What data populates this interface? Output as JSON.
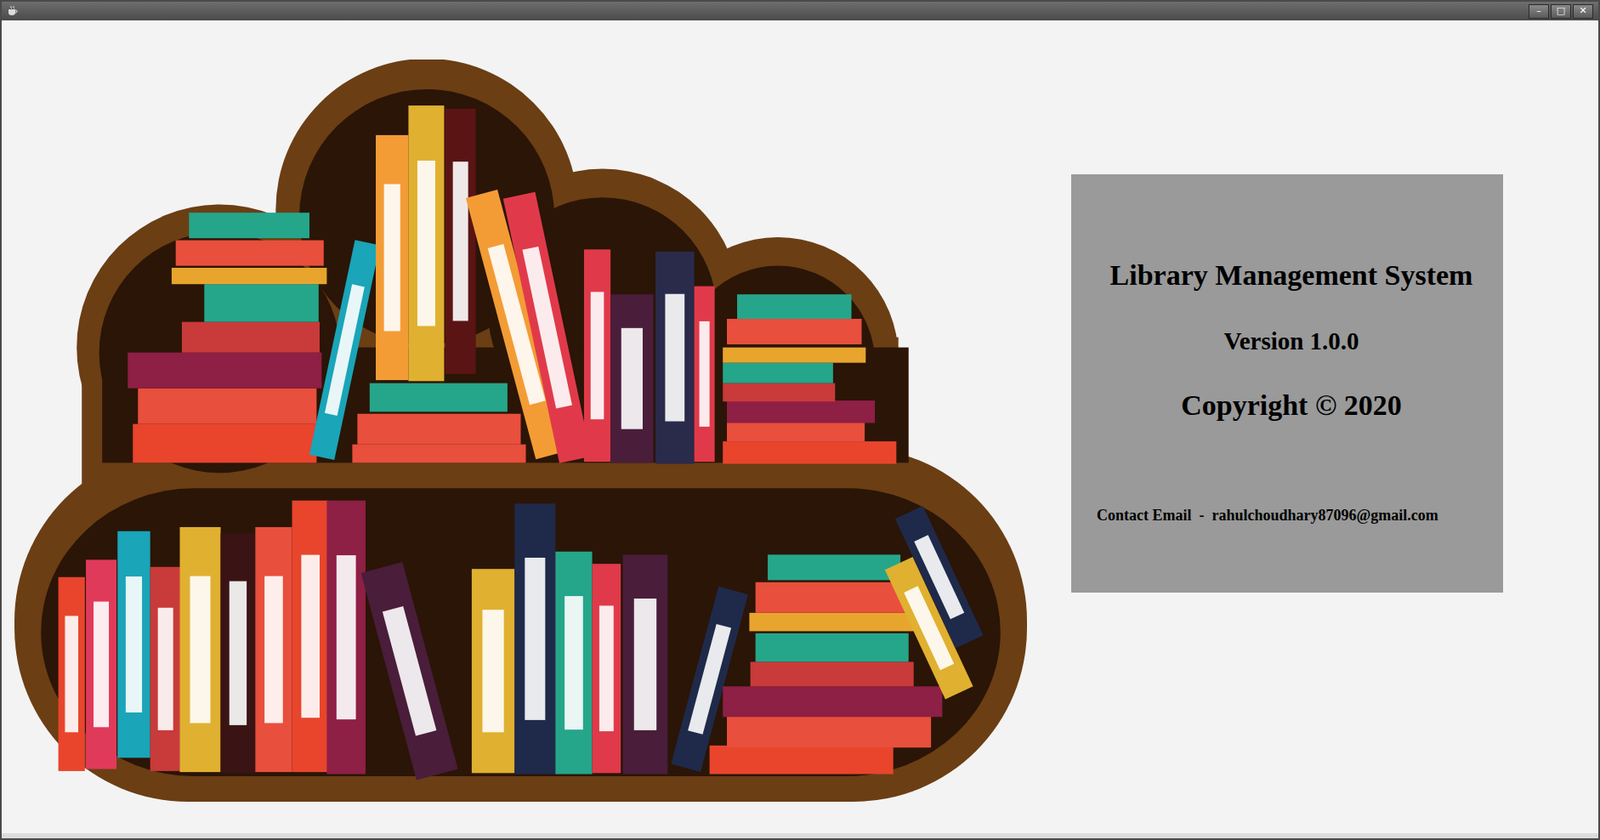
{
  "window": {
    "controls": [
      "–",
      "□",
      "✕"
    ]
  },
  "about": {
    "title": "Library Management System",
    "version": "Version 1.0.0",
    "copyright": "Copyright © 2020",
    "contact": "Contact Email  -  rahulchoudhary87096@gmail.com"
  }
}
